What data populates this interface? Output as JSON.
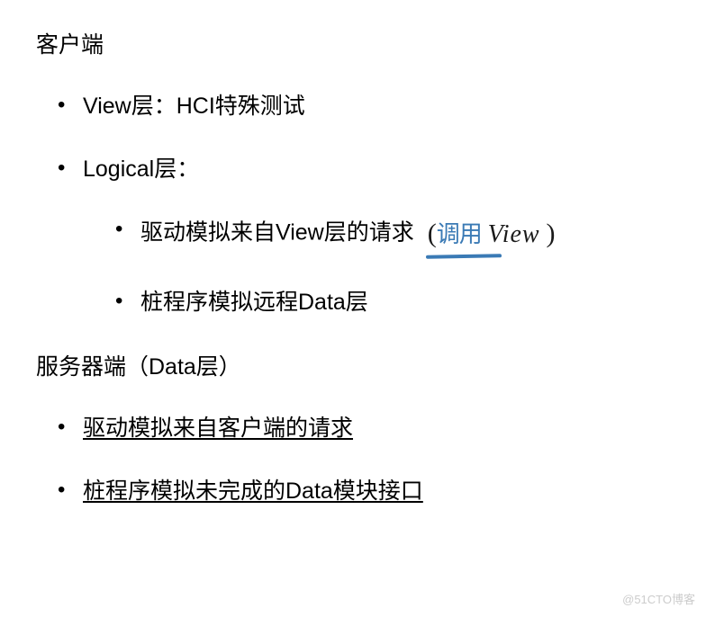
{
  "section1": {
    "title": "客户端",
    "items": [
      {
        "text": "View层：HCI特殊测试"
      },
      {
        "text": "Logical层：",
        "sub": [
          {
            "text": "驱动模拟来自View层的请求",
            "annotation_cn": "调用",
            "annotation_view": "View",
            "paren_open": "(",
            "paren_close": ")"
          },
          {
            "text": "桩程序模拟远程Data层"
          }
        ]
      }
    ]
  },
  "section2": {
    "title": "服务器端（Data层）",
    "items": [
      {
        "text": "驱动模拟来自客户端的请求"
      },
      {
        "text": "桩程序模拟未完成的Data模块接口"
      }
    ]
  },
  "watermark": "@51CTO博客"
}
